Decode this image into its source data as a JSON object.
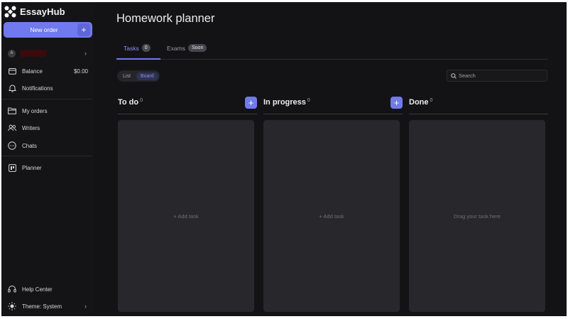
{
  "app": {
    "brand": "EssayHub"
  },
  "sidebar": {
    "new_order_label": "New order",
    "new_order_plus": "+",
    "profile": {
      "initial": "A",
      "chevron": "›"
    },
    "balance": {
      "label": "Balance",
      "value": "$0.00"
    },
    "notifications": {
      "label": "Notifications"
    },
    "my_orders": {
      "label": "My orders"
    },
    "writers": {
      "label": "Writers"
    },
    "chats": {
      "label": "Chats"
    },
    "planner": {
      "label": "Planner"
    },
    "help_center": {
      "label": "Help Center"
    },
    "theme": {
      "label": "Theme: System",
      "chevron": "›"
    }
  },
  "main": {
    "title": "Homework planner",
    "tabs": [
      {
        "label": "Tasks",
        "badge": "0"
      },
      {
        "label": "Exams",
        "badge": "Soon"
      }
    ],
    "view_toggle": {
      "list": "List",
      "board": "Board",
      "selected": "Board"
    },
    "search": {
      "placeholder": "Search",
      "value": ""
    },
    "columns": [
      {
        "title": "To do",
        "count": "0",
        "has_add": true,
        "empty_text": "+ Add task"
      },
      {
        "title": "In progress",
        "count": "0",
        "has_add": true,
        "empty_text": "+ Add task"
      },
      {
        "title": "Done",
        "count": "0",
        "has_add": false,
        "empty_text": "Drag your task here"
      }
    ]
  },
  "colors": {
    "accent": "#7179ee",
    "background": "#131316",
    "card": "#27272c"
  },
  "icons": {
    "logo": "essayhub-logo-icon",
    "balance": "wallet-icon",
    "notifications": "bell-icon",
    "my_orders": "folder-icon",
    "writers": "users-icon",
    "chats": "chat-bubble-icon",
    "planner": "planner-icon",
    "help_center": "headset-icon",
    "theme": "sun-icon",
    "search": "search-icon"
  }
}
